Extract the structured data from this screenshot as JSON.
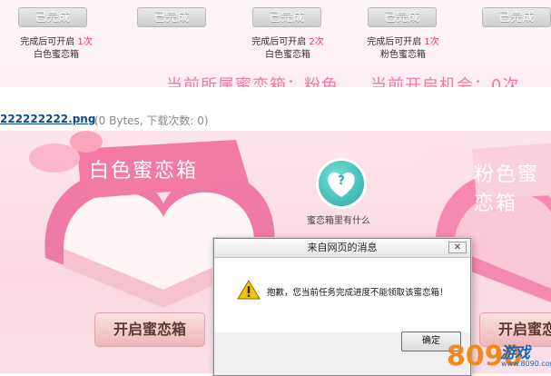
{
  "rewards": [
    {
      "button": "已完成"
    },
    {
      "button": "已完成"
    },
    {
      "button": "已完成"
    },
    {
      "button": "已完成"
    },
    {
      "button": "已完成"
    }
  ],
  "tasks": [
    {
      "line_prefix": "完成后可开启",
      "count": "1次",
      "box": "白色蜜恋箱"
    },
    {
      "line_prefix": "完成后可开启",
      "count": "2次",
      "box": "白色蜜恋箱"
    },
    {
      "line_prefix": "完成后可开启",
      "count": "1次",
      "box": "粉色蜜恋箱"
    }
  ],
  "status": {
    "current_box": "当前所属蜜恋箱：粉色",
    "open_chances": "当前开启机会：0次"
  },
  "file": {
    "name": "222222222.png",
    "meta": "(0 Bytes, 下载次数: 0)"
  },
  "stage": {
    "white_box_label": "白色蜜恋箱",
    "pink_box_label": "粉色蜜恋箱",
    "open_button": "开启蜜恋箱",
    "open_button_right": "开启蜜恋箱",
    "whats_inside": "蜜恋箱里有什么",
    "question_mark": "?"
  },
  "dialog": {
    "title": "来自网页的消息",
    "close": "✕",
    "message": "抱歉，您当前任务完成进度不能领取该蜜恋箱！",
    "ok": "确定"
  },
  "watermark": {
    "brand": "8090",
    "text": "游戏",
    "url": "www.8090.com"
  },
  "colors": {
    "accent_pink": "#f27aa0",
    "teal": "#2ca9a4",
    "link": "#114a8b"
  }
}
